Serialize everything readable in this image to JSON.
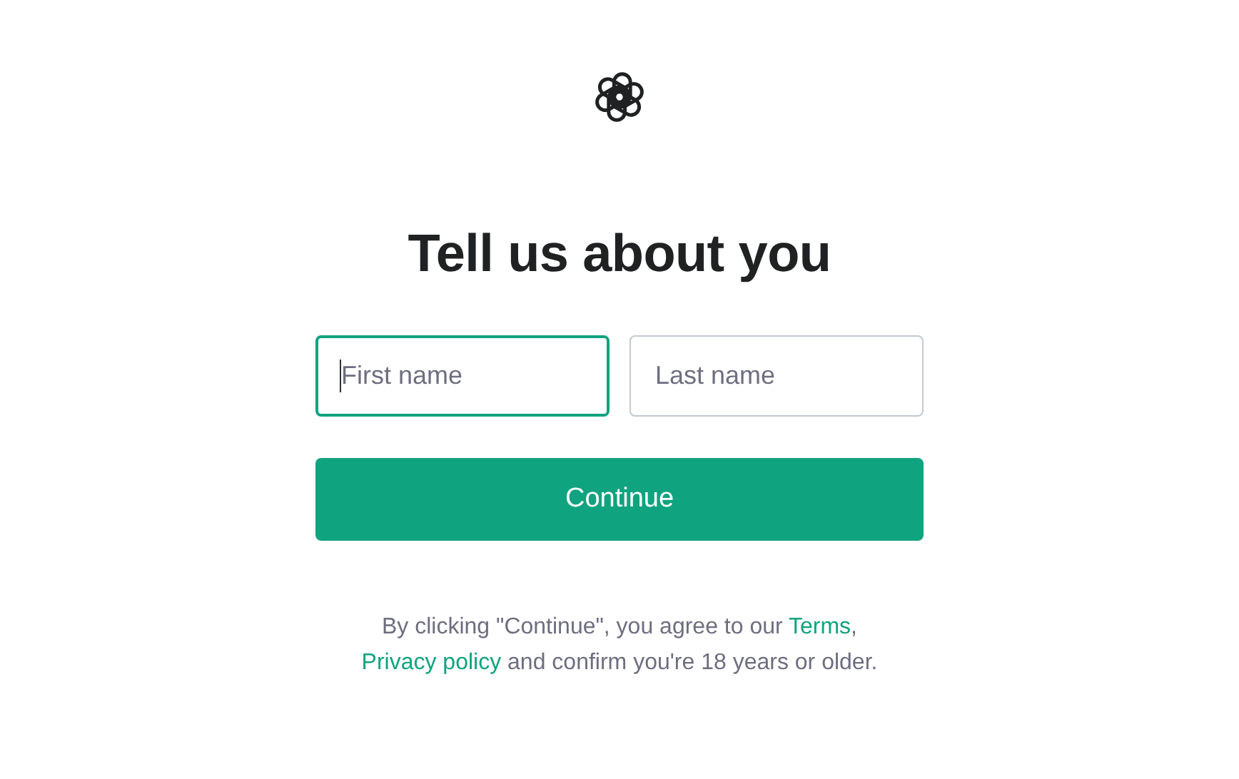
{
  "title": "Tell us about you",
  "fields": [
    {
      "placeholder": "First name",
      "focused": true
    },
    {
      "placeholder": "Last name",
      "focused": false
    }
  ],
  "button": "Continue",
  "notice": [
    {
      "kind": "text",
      "text": "By clicking \"Continue\", you agree to our "
    },
    {
      "kind": "link",
      "text": "Terms"
    },
    {
      "kind": "text",
      "text": ", "
    },
    {
      "kind": "link",
      "text": "Privacy policy"
    },
    {
      "kind": "text",
      "text": " and confirm you're 18 years or older."
    }
  ]
}
